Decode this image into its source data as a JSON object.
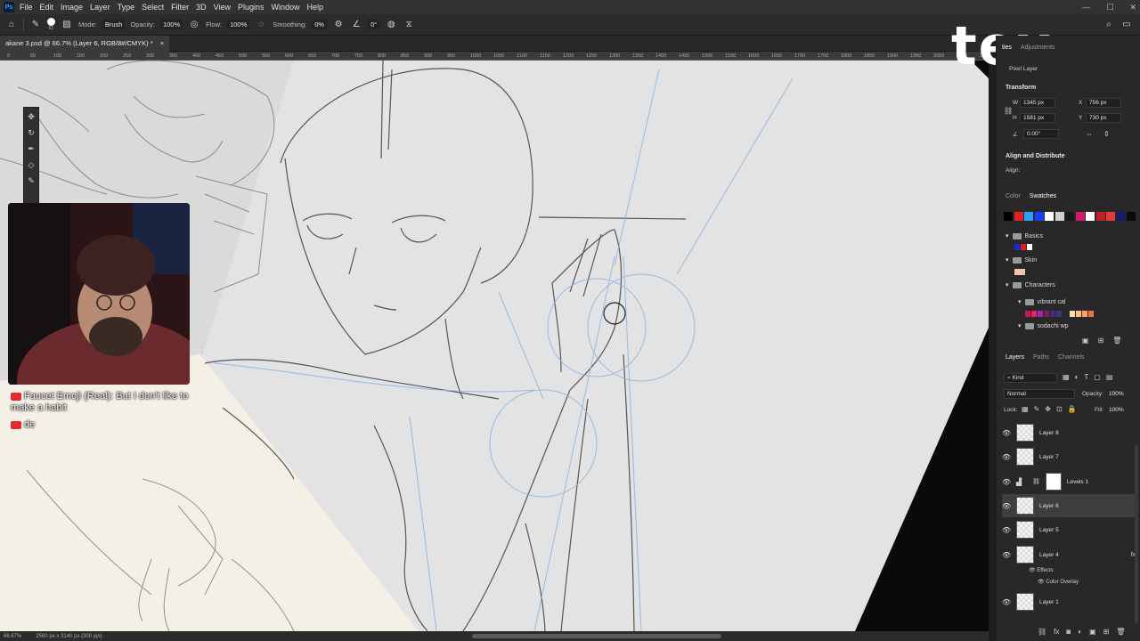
{
  "menubar": {
    "logo": "Ps",
    "items": [
      "File",
      "Edit",
      "Image",
      "Layer",
      "Type",
      "Select",
      "Filter",
      "3D",
      "View",
      "Plugins",
      "Window",
      "Help"
    ],
    "window_controls": [
      "—",
      "☐",
      "✕"
    ]
  },
  "options": {
    "brush_size": "61",
    "mode_label": "Mode:",
    "mode_value": "Brush",
    "opacity_label": "Opacity:",
    "opacity_value": "100%",
    "flow_label": "Flow:",
    "flow_value": "100%",
    "smoothing_label": "Smoothing:",
    "smoothing_value": "0%",
    "angle_value": "0°"
  },
  "document": {
    "tab_title": "akane 3.psd @ 66.7% (Layer 6, RGB/8#/CMYK) *",
    "close": "×"
  },
  "ruler_ticks": [
    "0",
    "50",
    "100",
    "150",
    "200",
    "250",
    "300",
    "350",
    "400",
    "450",
    "500",
    "550",
    "600",
    "650",
    "700",
    "750",
    "800",
    "850",
    "900",
    "950",
    "1000",
    "1050",
    "1100",
    "1150",
    "1200",
    "1250",
    "1300",
    "1350",
    "1400",
    "1450",
    "1500",
    "1550",
    "1600",
    "1650",
    "1700",
    "1750",
    "1800",
    "1850",
    "1900",
    "1950",
    "2000",
    "2050",
    "2100"
  ],
  "status": {
    "zoom": "66.67%",
    "doc_size": "2560 px x 3140 px (300 ppi)"
  },
  "chat": {
    "messages": [
      {
        "author": "Faucet Emoji (Real):",
        "text": "But I don't like to make a habit"
      },
      {
        "author": "de",
        "text": ""
      }
    ]
  },
  "overlay": {
    "text": "tex"
  },
  "properties": {
    "tabs": [
      "ties",
      "Adjustments"
    ],
    "kind": "Pixel Layer",
    "transform_title": "Transform",
    "w_label": "W",
    "w_value": "1345 px",
    "h_label": "H",
    "h_value": "1581 px",
    "x_label": "X",
    "x_value": "756 px",
    "y_label": "Y",
    "y_value": "730 px",
    "angle_value": "0.00°",
    "align_title": "Align and Distribute",
    "align_label": "Align:"
  },
  "swatches": {
    "tabs": [
      "Color",
      "Swatches"
    ],
    "top_colors": [
      "#000000",
      "#e02020",
      "#2aa0ff",
      "#1a3cff",
      "#ffffff",
      "#cfcfcf",
      "#1a1a1a",
      "#d41a6a",
      "#ffffff",
      "#c0202c",
      "#e83a3a",
      "#1b1b6e",
      "#0a0a0a"
    ],
    "groups": [
      {
        "name": "Basics",
        "colors": [
          "#1e2ad8",
          "#e02020",
          "#ffffff"
        ]
      },
      {
        "name": "Skin",
        "colors": [
          "#f2c2b0"
        ]
      },
      {
        "name": "Characters",
        "colors": []
      },
      {
        "name": "vibrant cal",
        "colors": [
          "#c2185b",
          "#e91e63",
          "#9c27b0",
          "#7a1f5c",
          "#4a2a6e",
          "#2e3a8a",
          "#ffd9b0",
          "#ffbf80",
          "#ff9f60",
          "#e07a40"
        ]
      },
      {
        "name": "sodachi wp",
        "colors": []
      }
    ]
  },
  "layers": {
    "tabs": [
      "Layers",
      "Paths",
      "Channels"
    ],
    "filter_label": "Kind",
    "blend_mode": "Normal",
    "opacity_label": "Opacity:",
    "opacity_value": "100%",
    "lock_label": "Lock:",
    "fill_label": "Fill:",
    "fill_value": "100%",
    "items": [
      {
        "name": "Layer 8"
      },
      {
        "name": "Layer 7"
      },
      {
        "name": "Levels 1"
      },
      {
        "name": "Layer 6"
      },
      {
        "name": "Layer 5"
      },
      {
        "name": "Layer 4"
      },
      {
        "name": "Layer 1"
      }
    ],
    "effects_label": "Effects",
    "effect_name": "Color Overlay",
    "fx": "fx"
  }
}
